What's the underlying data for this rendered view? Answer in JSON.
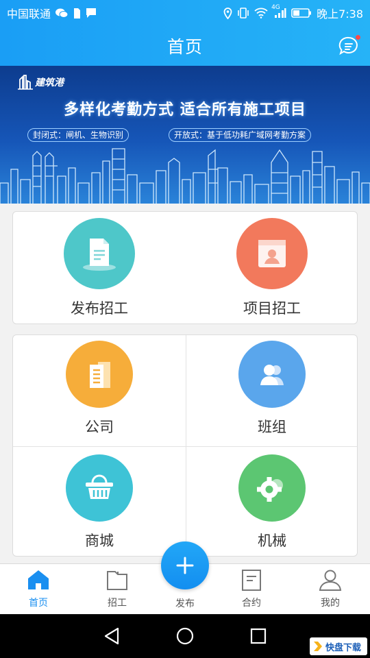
{
  "status_bar": {
    "carrier": "中国联通",
    "network": "4G",
    "time": "晚上7:38"
  },
  "header": {
    "title": "首页"
  },
  "banner": {
    "logo_text": "建筑港",
    "headline": "多样化考勤方式  适合所有施工项目",
    "tag_closed": "封闭式：闸机、生物识别",
    "tag_open": "开放式：基于低功耗广域网考勤方案"
  },
  "quick_actions": [
    {
      "label": "发布招工",
      "icon": "document-icon",
      "color": "#4ec7c9"
    },
    {
      "label": "项目招工",
      "icon": "id-card-icon",
      "color": "#f2795c"
    }
  ],
  "categories": [
    {
      "label": "公司",
      "icon": "building-icon",
      "color": "#f6ad3a"
    },
    {
      "label": "班组",
      "icon": "team-icon",
      "color": "#5aa6ec"
    },
    {
      "label": "商城",
      "icon": "basket-icon",
      "color": "#3ec3d6"
    },
    {
      "label": "机械",
      "icon": "gear-icon",
      "color": "#5cc672"
    }
  ],
  "tab_bar": {
    "items": [
      {
        "label": "首页",
        "icon": "home-icon",
        "active": true
      },
      {
        "label": "招工",
        "icon": "folder-icon",
        "active": false
      },
      {
        "label": "发布",
        "icon": "plus-icon",
        "active": false
      },
      {
        "label": "合约",
        "icon": "contract-icon",
        "active": false
      },
      {
        "label": "我的",
        "icon": "user-icon",
        "active": false
      }
    ]
  },
  "colors": {
    "brand_blue": "#1a9ef5",
    "active_tab": "#1a8ff0"
  },
  "watermark": {
    "text": "快盘下载"
  }
}
